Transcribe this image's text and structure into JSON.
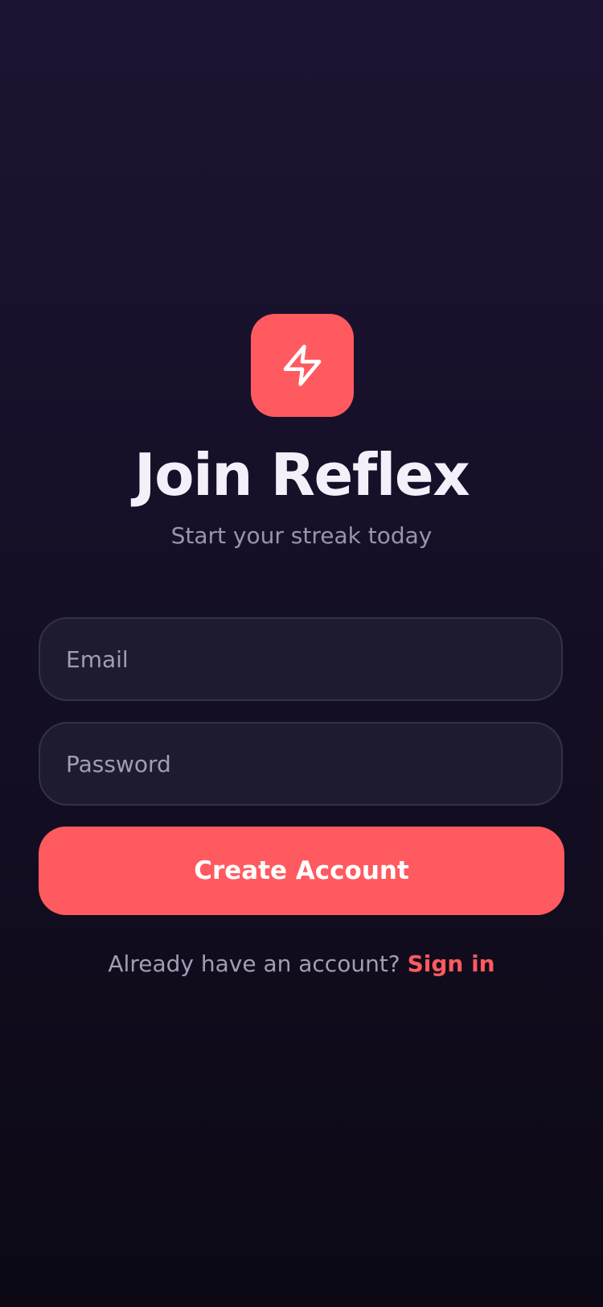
{
  "app": {
    "logo_icon": "lightning-bolt-icon",
    "accent_color": "#ff5a5f"
  },
  "header": {
    "title": "Join Reflex",
    "subtitle": "Start your streak today"
  },
  "form": {
    "email_placeholder": "Email",
    "email_value": "",
    "password_placeholder": "Password",
    "password_value": "",
    "submit_label": "Create Account"
  },
  "footer": {
    "prompt": "Already have an account?",
    "link_label": "Sign in"
  }
}
